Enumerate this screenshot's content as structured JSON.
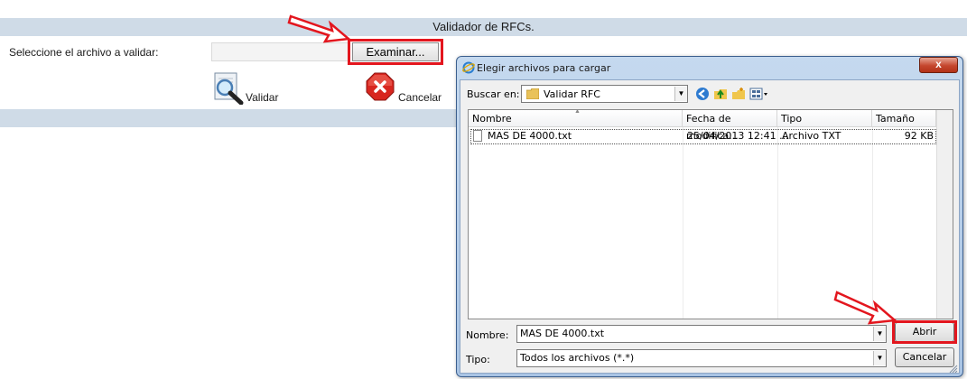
{
  "page": {
    "title": "Validador de RFCs.",
    "select_label": "Seleccione el archivo a validar:",
    "file_input_value": "",
    "browse_button": "Examinar...",
    "validate_label": "Validar",
    "cancel_label": "Cancelar"
  },
  "dialog": {
    "title": "Elegir archivos para cargar",
    "look_in_label": "Buscar en:",
    "look_in_value": "Validar RFC",
    "toolbar_icons": [
      "back-icon",
      "up-folder-icon",
      "new-folder-icon",
      "view-menu-icon"
    ],
    "columns": [
      "Nombre",
      "Fecha de modifica...",
      "Tipo",
      "Tamaño"
    ],
    "files": [
      {
        "name": "MAS DE 4000.txt",
        "modified": "25/04/2013 12:41 ...",
        "type": "Archivo TXT",
        "size": "92 KB"
      }
    ],
    "filename_label": "Nombre:",
    "filename_value": "MAS DE 4000.txt",
    "filetype_label": "Tipo:",
    "filetype_value": "Todos los archivos (*.*)",
    "open_button": "Abrir",
    "cancel_button": "Cancelar",
    "close_glyph": "x"
  },
  "colors": {
    "header_bar": "#cfdbe7",
    "highlight": "#e3161e",
    "dialog_frame": "#a9c4e4"
  }
}
